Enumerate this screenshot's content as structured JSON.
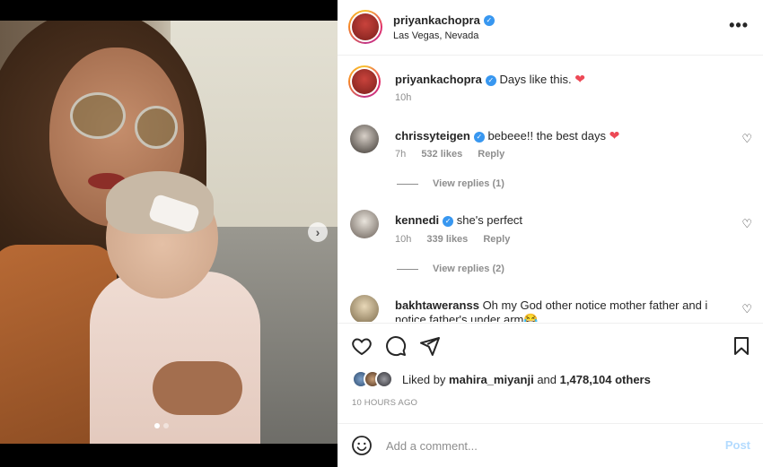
{
  "post": {
    "author": "priyankachopra",
    "location": "Las Vegas, Nevada",
    "more_glyph": "•••"
  },
  "caption": {
    "username": "priyankachopra",
    "text": "Days like this.",
    "emoji": "❤",
    "time": "10h"
  },
  "comments": [
    {
      "username": "chrissyteigen",
      "verified": true,
      "text": "bebeee!! the best days",
      "emoji": "❤",
      "time": "7h",
      "likes": "532 likes",
      "reply": "Reply",
      "view_replies": "View replies (1)"
    },
    {
      "username": "kennedi",
      "verified": true,
      "text": "she's perfect",
      "time": "10h",
      "likes": "339 likes",
      "reply": "Reply",
      "view_replies": "View replies (2)"
    },
    {
      "username": "bakhtaweranss",
      "verified": false,
      "text": "Oh my God other notice mother father and i",
      "text2": "notice father's under arm😂"
    }
  ],
  "likes": {
    "prefix": "Liked by",
    "user": "mahira_miyanji",
    "and": "and",
    "others": "1,478,104 others"
  },
  "timestamp": "10 HOURS AGO",
  "add_comment": {
    "placeholder": "Add a comment...",
    "post_label": "Post"
  },
  "colors": {
    "verified": "#3897f0",
    "heart": "#ed4956",
    "post_disabled": "#b3dbff"
  },
  "carousel": {
    "slides": 2,
    "active": 1
  }
}
